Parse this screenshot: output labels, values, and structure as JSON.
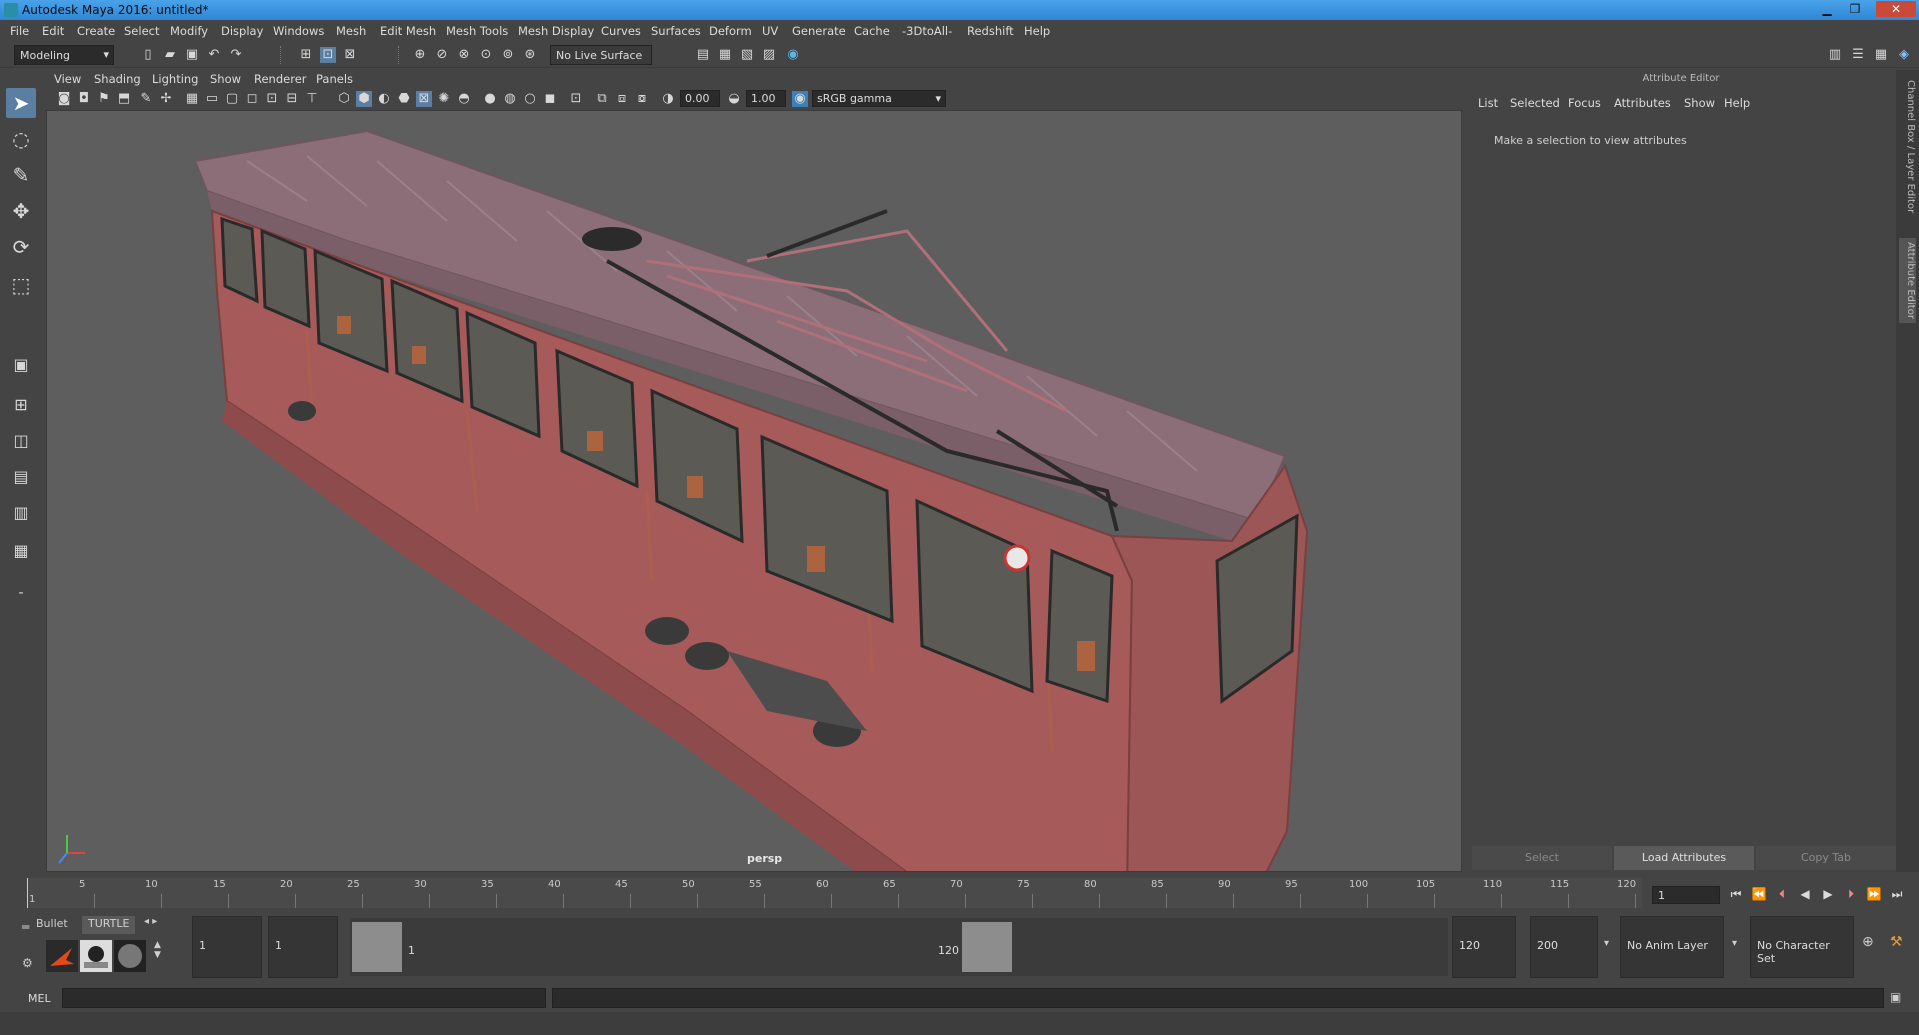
{
  "window": {
    "title": "Autodesk Maya 2016: untitled*",
    "min": "▁",
    "max": "❐",
    "close": "✕"
  },
  "menus": [
    "File",
    "Edit",
    "Create",
    "Select",
    "Modify",
    "Display",
    "Windows",
    "Mesh",
    "Edit Mesh",
    "Mesh Tools",
    "Mesh Display",
    "Curves",
    "Surfaces",
    "Deform",
    "UV",
    "Generate",
    "Cache",
    "-3DtoAll-",
    "Redshift",
    "Help"
  ],
  "status": {
    "mode": "Modeling",
    "live_surface": "No Live Surface"
  },
  "viewport": {
    "menus": [
      "View",
      "Shading",
      "Lighting",
      "Show",
      "Renderer",
      "Panels"
    ],
    "exposure": "0.00",
    "gamma": "1.00",
    "colorspace": "sRGB gamma",
    "camera": "persp"
  },
  "attribute_editor": {
    "title": "Attribute Editor",
    "tabs": [
      "List",
      "Selected",
      "Focus",
      "Attributes",
      "Show",
      "Help"
    ],
    "message": "Make a selection to view attributes",
    "buttons": {
      "select": "Select",
      "load": "Load Attributes",
      "copy": "Copy Tab"
    }
  },
  "side_tabs": {
    "channel": "Channel Box / Layer Editor",
    "attr": "Attribute Editor"
  },
  "timeline": {
    "ticks": [
      "5",
      "10",
      "15",
      "20",
      "25",
      "30",
      "35",
      "40",
      "45",
      "50",
      "55",
      "60",
      "65",
      "70",
      "75",
      "80",
      "85",
      "90",
      "95",
      "100",
      "105",
      "110",
      "115",
      "120"
    ],
    "start_label": "1",
    "current_frame": "1"
  },
  "shelf": {
    "tab1": "Bullet",
    "tab2": "TURTLE"
  },
  "range": {
    "start": "1",
    "playback_start": "1",
    "slider_start": "1",
    "slider_end": "120",
    "playback_end": "120",
    "end": "200",
    "anim_layer": "No Anim Layer",
    "character_set": "No Character Set"
  },
  "script": {
    "label": "MEL"
  },
  "colors": {
    "viewport_bg": "#5e5e5e",
    "panel": "#444444",
    "title_bar": "#3b95de",
    "tram_body": "#a65a5a"
  }
}
